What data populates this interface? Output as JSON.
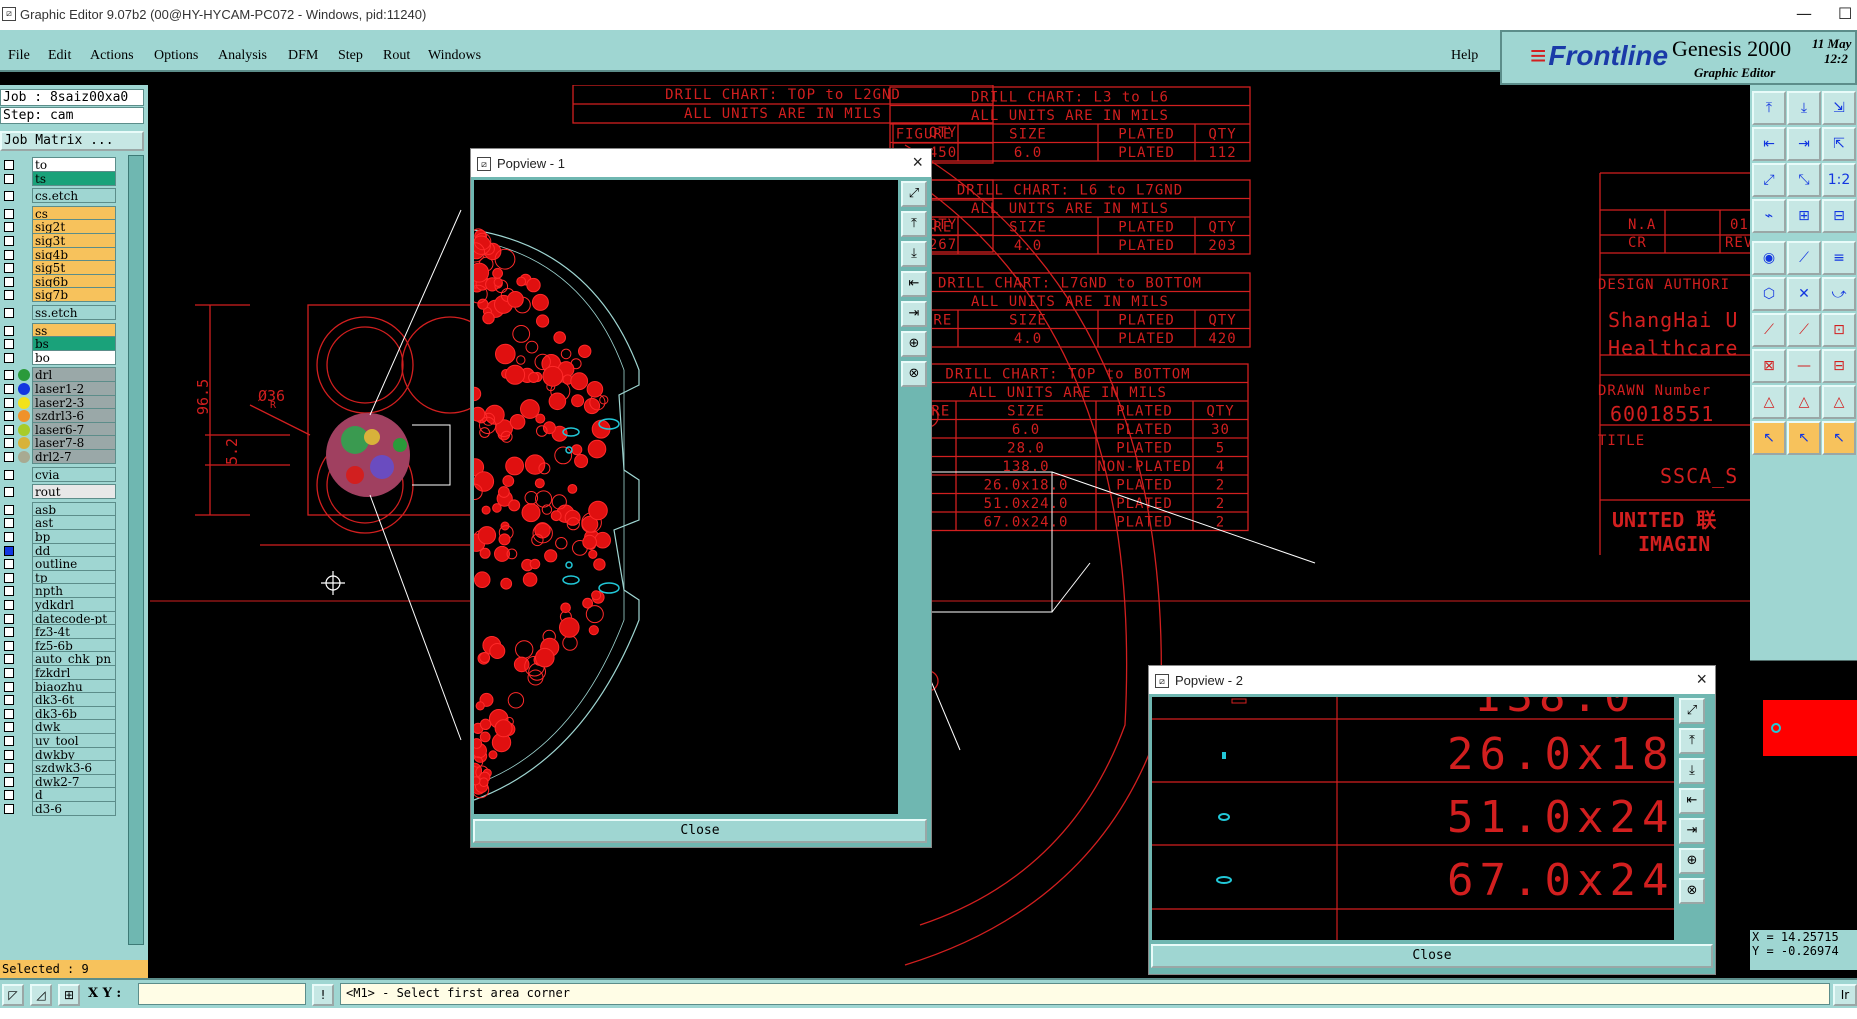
{
  "window": {
    "title": "Graphic Editor 9.07b2 (00@HY-HYCAM-PC072 - Windows, pid:11240)"
  },
  "menu": {
    "items": [
      "File",
      "Edit",
      "Actions",
      "Options",
      "Analysis",
      "DFM",
      "Step",
      "Rout",
      "Windows"
    ],
    "help": "Help"
  },
  "brand": {
    "logo": "Frontline",
    "product": "Genesis 2000",
    "subtitle": "Graphic Editor",
    "date_line1": "11 May",
    "date_line2": "12:2"
  },
  "job": {
    "job_line": "Job : 8saiz00xa0",
    "step_line": "Step: cam",
    "job_matrix": "Job Matrix ...",
    "selected": "Selected : 9"
  },
  "layers": [
    {
      "name": "to",
      "bg": "#ffffff",
      "dot": ""
    },
    {
      "name": "ts",
      "bg": "#1aa27a",
      "dot": ""
    },
    {
      "name": "cs.etch",
      "bg": "#9fd6d2",
      "dot": ""
    },
    {
      "name": "cs",
      "bg": "#f7c25c",
      "dot": ""
    },
    {
      "name": "sig2t",
      "bg": "#f7c25c",
      "dot": ""
    },
    {
      "name": "sig3t",
      "bg": "#f7c25c",
      "dot": ""
    },
    {
      "name": "sig4b",
      "bg": "#f7c25c",
      "dot": ""
    },
    {
      "name": "sig5t",
      "bg": "#f7c25c",
      "dot": ""
    },
    {
      "name": "sig6b",
      "bg": "#f7c25c",
      "dot": ""
    },
    {
      "name": "sig7b",
      "bg": "#f7c25c",
      "dot": ""
    },
    {
      "name": "ss.etch",
      "bg": "#9fd6d2",
      "dot": ""
    },
    {
      "name": "ss",
      "bg": "#f7c25c",
      "dot": ""
    },
    {
      "name": "bs",
      "bg": "#1aa27a",
      "dot": ""
    },
    {
      "name": "bo",
      "bg": "#ffffff",
      "dot": ""
    },
    {
      "name": "drl",
      "bg": "#9aa8a8",
      "dot": "#2a9a3a"
    },
    {
      "name": "laser1-2",
      "bg": "#9aa8a8",
      "dot": "#1236e0"
    },
    {
      "name": "laser2-3",
      "bg": "#9aa8a8",
      "dot": "#f2e21a"
    },
    {
      "name": "szdrl3-6",
      "bg": "#9aa8a8",
      "dot": "#f0922a"
    },
    {
      "name": "laser6-7",
      "bg": "#9aa8a8",
      "dot": "#a8cc2a"
    },
    {
      "name": "laser7-8",
      "bg": "#9aa8a8",
      "dot": "#d8b23a"
    },
    {
      "name": "drl2-7",
      "bg": "#9aa8a8",
      "dot": "#a8aa92"
    },
    {
      "name": "cvia",
      "bg": "#9fd6d2",
      "dot": ""
    },
    {
      "name": "rout",
      "bg": "#e8e8e8",
      "dot": ""
    },
    {
      "name": "asb",
      "bg": "#9fd6d2",
      "dot": ""
    },
    {
      "name": "ast",
      "bg": "#9fd6d2",
      "dot": ""
    },
    {
      "name": "bp",
      "bg": "#9fd6d2",
      "dot": ""
    },
    {
      "name": "dd",
      "bg": "#9fd6d2",
      "dot": ""
    },
    {
      "name": "outline",
      "bg": "#9fd6d2",
      "dot": ""
    },
    {
      "name": "tp",
      "bg": "#9fd6d2",
      "dot": ""
    },
    {
      "name": "npth",
      "bg": "#9fd6d2",
      "dot": ""
    },
    {
      "name": "ydkdrl",
      "bg": "#9fd6d2",
      "dot": ""
    },
    {
      "name": "datecode-pt",
      "bg": "#9fd6d2",
      "dot": ""
    },
    {
      "name": "fz3-4t",
      "bg": "#9fd6d2",
      "dot": ""
    },
    {
      "name": "fz5-6b",
      "bg": "#9fd6d2",
      "dot": ""
    },
    {
      "name": "auto_chk_pn",
      "bg": "#9fd6d2",
      "dot": ""
    },
    {
      "name": "fzkdrl",
      "bg": "#9fd6d2",
      "dot": ""
    },
    {
      "name": "biaozhu",
      "bg": "#9fd6d2",
      "dot": ""
    },
    {
      "name": "dk3-6t",
      "bg": "#9fd6d2",
      "dot": ""
    },
    {
      "name": "dk3-6b",
      "bg": "#9fd6d2",
      "dot": ""
    },
    {
      "name": "dwk",
      "bg": "#9fd6d2",
      "dot": ""
    },
    {
      "name": "uv_tool",
      "bg": "#9fd6d2",
      "dot": ""
    },
    {
      "name": "dwkby",
      "bg": "#9fd6d2",
      "dot": ""
    },
    {
      "name": "szdwk3-6",
      "bg": "#9fd6d2",
      "dot": ""
    },
    {
      "name": "dwk2-7",
      "bg": "#9fd6d2",
      "dot": ""
    },
    {
      "name": "d",
      "bg": "#9fd6d2",
      "dot": ""
    },
    {
      "name": "d3-6",
      "bg": "#9fd6d2",
      "dot": ""
    }
  ],
  "drill_charts": {
    "top_l2gnd": {
      "title": "DRILL CHART: TOP to L2GND",
      "units": "ALL UNITS ARE IN MILS",
      "qty_label": "QTY",
      "qty1": "450",
      "qty2": "267"
    },
    "l3_l6": {
      "title": "DRILL CHART: L3 to L6",
      "units": "ALL UNITS ARE IN MILS",
      "headers": [
        "FIGURE",
        "SIZE",
        "PLATED",
        "QTY"
      ],
      "rows": [
        [
          "6.0",
          "PLATED",
          "112"
        ]
      ]
    },
    "l6_l7gnd": {
      "title": "DRILL CHART: L6 to L7GND",
      "units": "ALL UNITS ARE IN MILS",
      "headers": [
        "FIGURE",
        "SIZE",
        "PLATED",
        "QTY"
      ],
      "rows": [
        [
          "4.0",
          "PLATED",
          "203"
        ]
      ]
    },
    "l7gnd_bottom": {
      "title": "DRILL CHART: L7GND to BOTTOM",
      "units": "ALL UNITS ARE IN MILS",
      "headers": [
        "FIGURE",
        "SIZE",
        "PLATED",
        "QTY"
      ],
      "rows": [
        [
          "4.0",
          "PLATED",
          "420"
        ]
      ]
    },
    "top_bottom": {
      "title": "DRILL CHART: TOP to BOTTOM",
      "units": "ALL UNITS ARE IN MILS",
      "headers": [
        "FIGURE",
        "SIZE",
        "PLATED",
        "QTY"
      ],
      "rows": [
        [
          "6.0",
          "PLATED",
          "30"
        ],
        [
          "28.0",
          "PLATED",
          "5"
        ],
        [
          "138.0",
          "NON-PLATED",
          "4"
        ],
        [
          "26.0x18.0",
          "PLATED",
          "2"
        ],
        [
          "51.0x24.0",
          "PLATED",
          "2"
        ],
        [
          "67.0x24.0",
          "PLATED",
          "2"
        ]
      ]
    }
  },
  "title_block": {
    "na": "N.A",
    "n01": "01",
    "cr": "CR",
    "rev": "REV",
    "design": "DESIGN AUTHORI",
    "company1": "ShangHai U",
    "company2": "Healthcare",
    "drawn": "DRAWN Number",
    "number": "60018551",
    "title": "TITLE",
    "ssca": "SSCA_S",
    "united": "UNITED 联",
    "imagin": "IMAGIN"
  },
  "dims": {
    "d1": "96.5",
    "d2": "Ø36",
    "d3": "5.2"
  },
  "popup1": {
    "title": "Popview - 1",
    "close": "Close"
  },
  "popup2": {
    "title": "Popview - 2",
    "close": "Close",
    "rows": [
      "26.0x18",
      "51.0x24",
      "67.0x24"
    ],
    "partial": "138.0"
  },
  "coords": {
    "x": "X = 14.25715",
    "y": "Y = -0.26974"
  },
  "status": {
    "xy_label": "X Y :",
    "prompt": "<M1> - Select first area corner",
    "right_btn": "Ir"
  },
  "colors": {
    "panel": "#9fd6d2",
    "red": "#d21f1f",
    "cyan": "#22c8d8",
    "layer_yellow": "#f7c25c",
    "layer_green": "#1aa27a"
  }
}
